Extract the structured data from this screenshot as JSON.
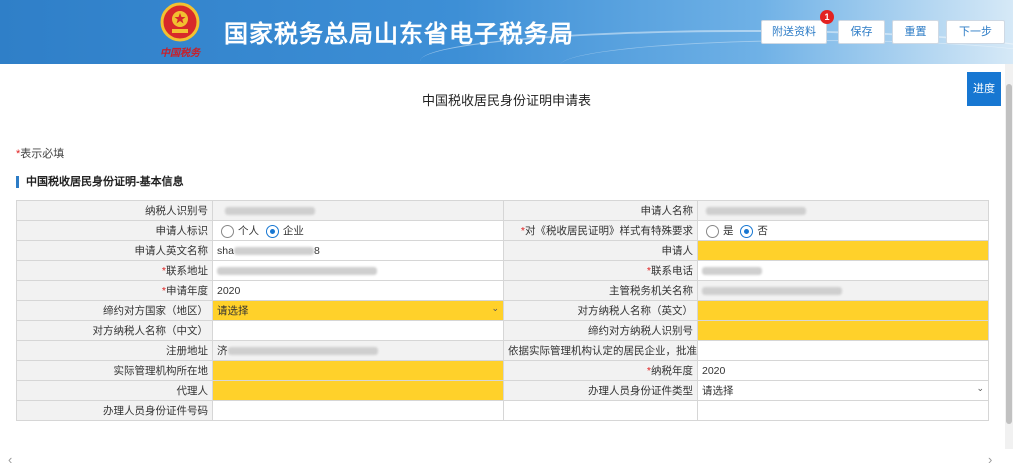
{
  "header": {
    "site_title": "国家税务总局山东省电子税务局",
    "brand_script": "中国税务",
    "buttons": {
      "attach": "附送资料",
      "attach_badge": "1",
      "save": "保存",
      "reset": "重置",
      "next": "下一步"
    }
  },
  "progress_label": "进度",
  "form_title": "中国税收居民身份证明申请表",
  "required_note": {
    "star": "*",
    "text": "表示必填"
  },
  "section_title": "中国税收居民身份证明-基本信息",
  "fields": {
    "taxpayer_id": {
      "label": "纳税人识别号"
    },
    "applicant_name": {
      "label": "申请人名称"
    },
    "applicant_type": {
      "label": "申请人标识",
      "opt1": "个人",
      "opt2": "企业"
    },
    "special_req": {
      "star": "*",
      "label": "对《税收居民证明》样式有特殊要求",
      "opt1": "是",
      "opt2": "否"
    },
    "english_name": {
      "label": "申请人英文名称",
      "value_prefix": "sha",
      "value_suffix": "8"
    },
    "applicant": {
      "label": "申请人"
    },
    "address": {
      "star": "*",
      "label": "联系地址"
    },
    "phone": {
      "star": "*",
      "label": "联系电话"
    },
    "apply_year": {
      "star": "*",
      "label": "申请年度",
      "value": "2020"
    },
    "tax_office": {
      "label": "主管税务机关名称"
    },
    "treaty_country": {
      "label": "缔约对方国家（地区）",
      "value": "请选择"
    },
    "counterparty_name_en": {
      "label": "对方纳税人名称（英文）"
    },
    "counterparty_name_cn": {
      "label": "对方纳税人名称（中文）"
    },
    "counterparty_id": {
      "label": "缔约对方纳税人识别号"
    },
    "reg_address": {
      "label": "注册地址",
      "value_prefix": "济"
    },
    "resident_doc": {
      "label": "依据实际管理机构认定的居民企业，批准文号"
    },
    "mgmt_location": {
      "label": "实际管理机构所在地"
    },
    "tax_year": {
      "star": "*",
      "label": "纳税年度",
      "value": "2020"
    },
    "agent": {
      "label": "代理人"
    },
    "handler_id_type": {
      "label": "办理人员身份证件类型",
      "value": "请选择"
    },
    "handler_id_no": {
      "label": "办理人员身份证件号码"
    }
  }
}
